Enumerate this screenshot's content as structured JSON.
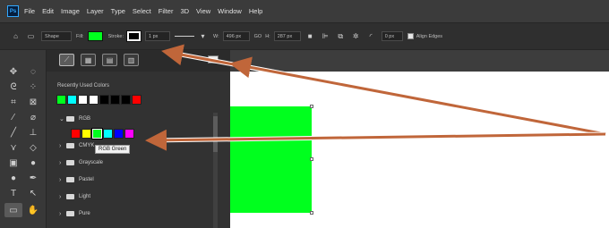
{
  "app": {
    "logo_text": "Ps"
  },
  "menu": [
    "File",
    "Edit",
    "Image",
    "Layer",
    "Type",
    "Select",
    "Filter",
    "3D",
    "View",
    "Window",
    "Help"
  ],
  "options_bar": {
    "mode": "Shape",
    "fill_label": "Fill:",
    "fill_color": "#00ff1e",
    "stroke_label": "Stroke:",
    "stroke_width": "1 px",
    "w_label": "W:",
    "w_value": "496 px",
    "link_label": "GO",
    "h_label": "H:",
    "h_value": "287 px",
    "radius_value": "0 px",
    "align_edges_label": "Align Edges"
  },
  "swatches_panel": {
    "recent_label": "Recently Used Colors",
    "recent_colors": [
      "#00ff1e",
      "#00ffff",
      "#ffffff",
      "#ffffff",
      "#000000",
      "#000000",
      "#000000",
      "#ff0000"
    ],
    "folders": [
      {
        "name": "RGB",
        "expanded": true,
        "colors": [
          "#ff0000",
          "#ffff00",
          "#00ff1e",
          "#00ffff",
          "#0000ff",
          "#ff00ff"
        ]
      },
      {
        "name": "CMYK",
        "expanded": false
      },
      {
        "name": "Grayscale",
        "expanded": false
      },
      {
        "name": "Pastel",
        "expanded": false
      },
      {
        "name": "Light",
        "expanded": false
      },
      {
        "name": "Pure",
        "expanded": false
      }
    ],
    "tooltip": "RGB Green"
  },
  "colors": {
    "accent_arrow": "#c0663a",
    "shape_fill": "#00ff1e"
  }
}
